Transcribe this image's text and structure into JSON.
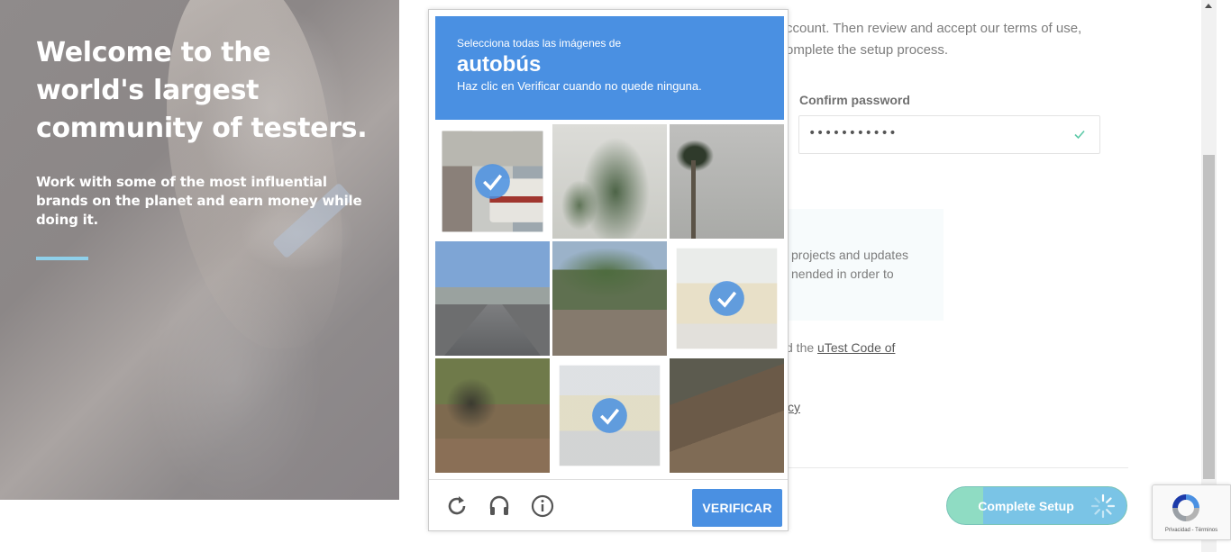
{
  "hero": {
    "title": "Welcome to the world's largest community of testers.",
    "subtitle": "Work with some of the most influential brands on the planet and earn money while doing it."
  },
  "form": {
    "intro_text": "ccount. Then review and accept our terms of use, omplete the setup process.",
    "confirm_password_label": "Confirm password",
    "confirm_password_value": "•••••••••••",
    "info_text": "projects and updates nended in order to",
    "coc_prefix": "d the ",
    "coc_link": "uTest Code of",
    "privacy_fragment": "cy",
    "complete_setup_label": "Complete Setup"
  },
  "captcha": {
    "prompt": "Selecciona todas las imágenes de",
    "keyword": "autobús",
    "instruction": "Haz clic en Verificar cuando no quede ninguna.",
    "tiles": [
      {
        "selected": true
      },
      {
        "selected": false
      },
      {
        "selected": false
      },
      {
        "selected": false
      },
      {
        "selected": false
      },
      {
        "selected": true
      },
      {
        "selected": false
      },
      {
        "selected": true
      },
      {
        "selected": false
      }
    ],
    "verify_label": "VERIFICAR",
    "icons": [
      "reload-icon",
      "audio-icon",
      "info-icon"
    ]
  },
  "recaptcha_badge": {
    "links": "Privacidad - Términos"
  },
  "colors": {
    "captcha_blue": "#4a90e2",
    "setup_green": "#8fdcc3",
    "setup_blue": "#7ac4e6",
    "hero_accent": "#8fd0ea",
    "check_green": "#5cc9a7"
  }
}
